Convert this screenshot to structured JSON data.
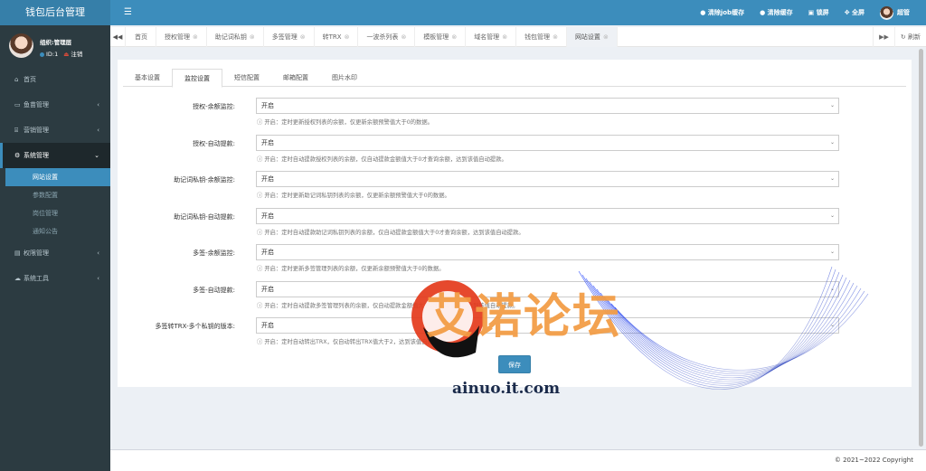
{
  "app": {
    "title": "钱包后台管理"
  },
  "user": {
    "org": "组织:管理层",
    "id": "ID:1",
    "logout": "注销"
  },
  "header": {
    "actions": [
      {
        "icon": "question-icon",
        "label": "清除job缓存"
      },
      {
        "icon": "question-icon",
        "label": "清除缓存"
      },
      {
        "icon": "lock-icon",
        "label": "锁屏"
      },
      {
        "icon": "fullscreen-icon",
        "label": "全屏"
      }
    ],
    "username": "超管"
  },
  "sidebar": {
    "items": [
      {
        "label": "首页",
        "icon": "home-icon",
        "glyph": "⌂",
        "arrow": ""
      },
      {
        "label": "鱼苗管理",
        "icon": "fish-icon",
        "glyph": "▭",
        "arrow": "‹"
      },
      {
        "label": "营销管理",
        "icon": "bank-icon",
        "glyph": "⌸",
        "arrow": "‹"
      },
      {
        "label": "系统管理",
        "icon": "gear-icon",
        "glyph": "⚙",
        "arrow": "⌄",
        "active": true,
        "children": [
          "网站设置",
          "参数配置",
          "岗位管理",
          "通知公告"
        ]
      },
      {
        "label": "权限管理",
        "icon": "list-icon",
        "glyph": "▤",
        "arrow": "‹"
      },
      {
        "label": "系统工具",
        "icon": "cloud-icon",
        "glyph": "☁",
        "arrow": "‹"
      }
    ]
  },
  "tabs": {
    "items": [
      "首页",
      "授权管理",
      "助记词私钥",
      "多签管理",
      "转TRX",
      "一波杀列表",
      "模板管理",
      "域名管理",
      "钱包管理",
      "网站设置"
    ],
    "active": "网站设置",
    "refresh": "刷新"
  },
  "subtabs": {
    "items": [
      "基本设置",
      "监控设置",
      "短信配置",
      "邮箱配置",
      "图片水印"
    ],
    "active": "监控设置"
  },
  "form": {
    "rows": [
      {
        "label": "授权-余额监控:",
        "value": "开启",
        "help": "开启：定时更新授权列表的余额，仅更新余额预警值大于0的数据。"
      },
      {
        "label": "授权-自动提款:",
        "value": "开启",
        "help": "开启：定时自动提款授权列表的余额，仅自动提款金额值大于0才查询余额，达到该值自动提款。"
      },
      {
        "label": "助记词私钥-余额监控:",
        "value": "开启",
        "help": "开启：定时更新助记词私钥列表的余额，仅更新余额预警值大于0的数据。"
      },
      {
        "label": "助记词私钥-自动提款:",
        "value": "开启",
        "help": "开启：定时自动提款助记词私钥列表的余额，仅自动提款金额值大于0才查询余额，达到该值自动提款。"
      },
      {
        "label": "多签-余额监控:",
        "value": "开启",
        "help": "开启：定时更新多签管理列表的余额，仅更新余额预警值大于0的数据。"
      },
      {
        "label": "多签-自动提款:",
        "value": "开启",
        "help": "开启：定时自动提款多签管理列表的余额，仅自动提款金额值大于0才查询余额，达到该值自动提款。"
      },
      {
        "label": "多签转TRX-多个私钥的版本:",
        "value": "开启",
        "help": "开启：定时自动转出TRX，仅自动转出TRX值大于2，达到该值自动转出。"
      }
    ],
    "save": "保存"
  },
  "footer": {
    "copyright": "© 2021~2022 Copyright"
  },
  "watermark": {
    "text": "艾诺论坛",
    "url": "ainuo.it.com"
  },
  "colors": {
    "header": "#3c8dbc",
    "brand": "#367fa9",
    "sidebar": "#2c3b41",
    "watermark": "#f39c43"
  }
}
